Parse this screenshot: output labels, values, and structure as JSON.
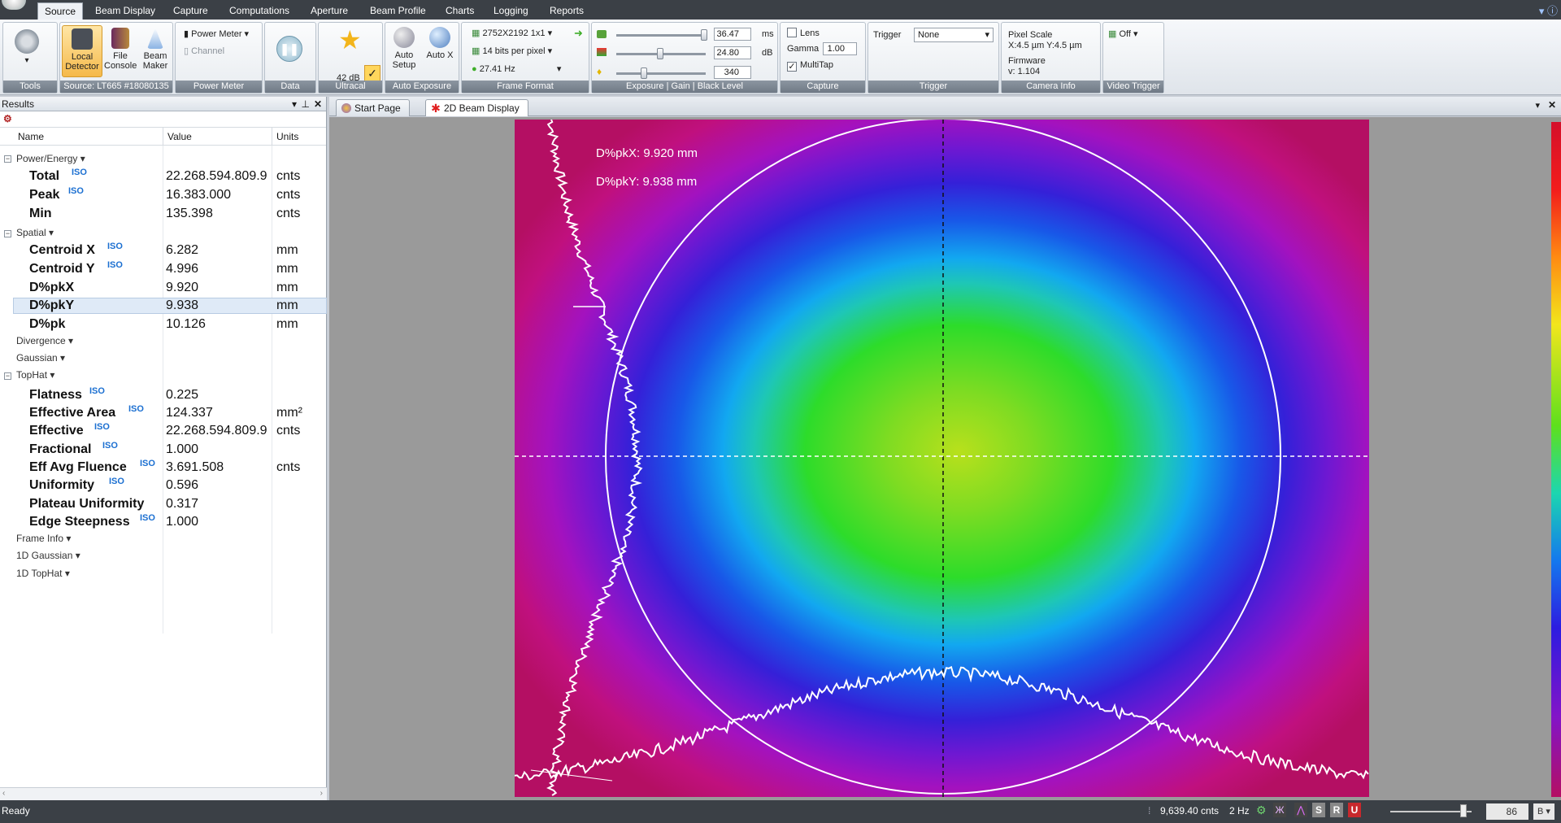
{
  "menu": {
    "tabs": [
      "Source",
      "Beam Display",
      "Capture",
      "Computations",
      "Aperture",
      "Beam Profile",
      "Charts",
      "Logging",
      "Reports"
    ],
    "active": "Source"
  },
  "ribbon": {
    "tools": {
      "label": "Tools"
    },
    "source": {
      "buttons": [
        "Local Detector",
        "File Console",
        "Beam Maker"
      ],
      "label": "Source: LT665 #18080135"
    },
    "power_meter": {
      "item1": "Power Meter",
      "item2": "Channel",
      "label": "Power Meter"
    },
    "data": {
      "label": "Data"
    },
    "ultracal": {
      "value": "42 dB",
      "label": "Ultracal"
    },
    "auto_exposure": {
      "btn1": "Auto Setup",
      "btn2": "Auto X",
      "label": "Auto Exposure"
    },
    "frame_format": {
      "resolution": "2752X2192 1x1",
      "bits": "14 bits per pixel",
      "rate": "27.41 Hz",
      "label": "Frame Format"
    },
    "exposure": {
      "exposure_value": "36.47",
      "exposure_unit": "ms",
      "gain_value": "24.80",
      "gain_unit": "dB",
      "black_value": "340",
      "label": "Exposure | Gain | Black Level"
    },
    "capture": {
      "lens": "Lens",
      "gamma_label": "Gamma",
      "gamma_value": "1.00",
      "multitap": "MultiTap",
      "label": "Capture"
    },
    "trigger": {
      "title": "Trigger",
      "value": "None",
      "label": "Trigger"
    },
    "camera_info": {
      "pixel_scale": "Pixel Scale",
      "xy": "X:4.5 µm  Y:4.5 µm",
      "firmware": "Firmware",
      "version": "v: 1.104",
      "label": "Camera Info"
    },
    "video_trigger": {
      "value": "Off",
      "label": "Video Trigger"
    }
  },
  "results": {
    "title": "Results",
    "headers": {
      "name": "Name",
      "value": "Value",
      "units": "Units"
    },
    "categories": {
      "power": "Power/Energy",
      "spatial": "Spatial",
      "divergence": "Divergence",
      "gaussian": "Gaussian",
      "tophat": "TopHat",
      "frame_info": "Frame Info",
      "gaussian1d": "1D Gaussian",
      "tophat1d": "1D TopHat"
    },
    "iso": "ISO",
    "rows": [
      {
        "name": "Total",
        "value": "22.268.594.809.9",
        "unit": "cnts"
      },
      {
        "name": "Peak",
        "value": "16.383.000",
        "unit": "cnts"
      },
      {
        "name": "Min",
        "value": "135.398",
        "unit": "cnts"
      },
      {
        "name": "Centroid X",
        "value": "6.282",
        "unit": "mm"
      },
      {
        "name": "Centroid Y",
        "value": "4.996",
        "unit": "mm"
      },
      {
        "name": "D%pkX",
        "value": "9.920",
        "unit": "mm"
      },
      {
        "name": "D%pkY",
        "value": "9.938",
        "unit": "mm"
      },
      {
        "name": "D%pk",
        "value": "10.126",
        "unit": "mm"
      },
      {
        "name": "Flatness",
        "value": "0.225",
        "unit": ""
      },
      {
        "name": "Effective Area",
        "value": "124.337",
        "unit": "mm²"
      },
      {
        "name": "Effective",
        "value": "22.268.594.809.9",
        "unit": "cnts"
      },
      {
        "name": "Fractional",
        "value": "1.000",
        "unit": ""
      },
      {
        "name": "Eff Avg Fluence",
        "value": "3.691.508",
        "unit": "cnts"
      },
      {
        "name": "Uniformity",
        "value": "0.596",
        "unit": ""
      },
      {
        "name": "Plateau Uniformity",
        "value": "0.317",
        "unit": ""
      },
      {
        "name": "Edge Steepness",
        "value": "1.000",
        "unit": ""
      }
    ]
  },
  "display": {
    "tabs": [
      "Start Page",
      "2D Beam Display"
    ],
    "overlay_x": "D%pkX: 9.920 mm",
    "overlay_y": "D%pkY: 9.938 mm"
  },
  "status": {
    "left": "Ready",
    "counts": "9,639.40 cnts",
    "rate": "2 Hz",
    "zoom": "86"
  }
}
